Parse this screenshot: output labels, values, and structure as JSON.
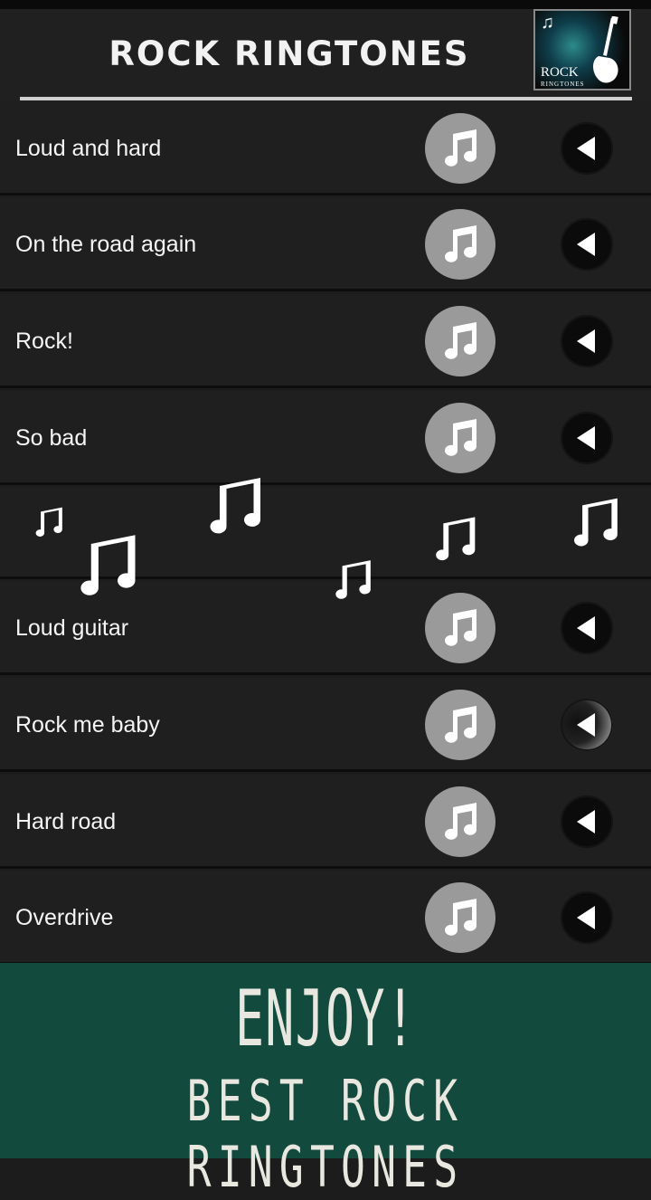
{
  "header": {
    "title": "ROCK RINGTONES",
    "logo_line1": "ROCK",
    "logo_line2": "RINGTONES"
  },
  "ringtones": [
    {
      "label": "Loud and hard",
      "play_state": "idle"
    },
    {
      "label": "On the road again",
      "play_state": "idle"
    },
    {
      "label": "Rock!",
      "play_state": "idle"
    },
    {
      "label": "So bad",
      "play_state": "idle"
    },
    {
      "label": "Loud guitar",
      "play_state": "idle"
    },
    {
      "label": "Rock me baby",
      "play_state": "active"
    },
    {
      "label": "Hard road",
      "play_state": "idle"
    },
    {
      "label": "Overdrive",
      "play_state": "idle"
    }
  ],
  "icons": {
    "set_ringtone": "music-note-icon",
    "play": "play-icon",
    "decor": "music-note-icon"
  },
  "promo": {
    "line1": "ENJOY!",
    "line2": "BEST ROCK RINGTONES"
  },
  "colors": {
    "background": "#1c1c1c",
    "row": "#1f1f1f",
    "note_button": "#9a9a9a",
    "play_button": "#0b0b0b",
    "promo_bg": "#124a3e",
    "text": "#f5f5f5"
  }
}
